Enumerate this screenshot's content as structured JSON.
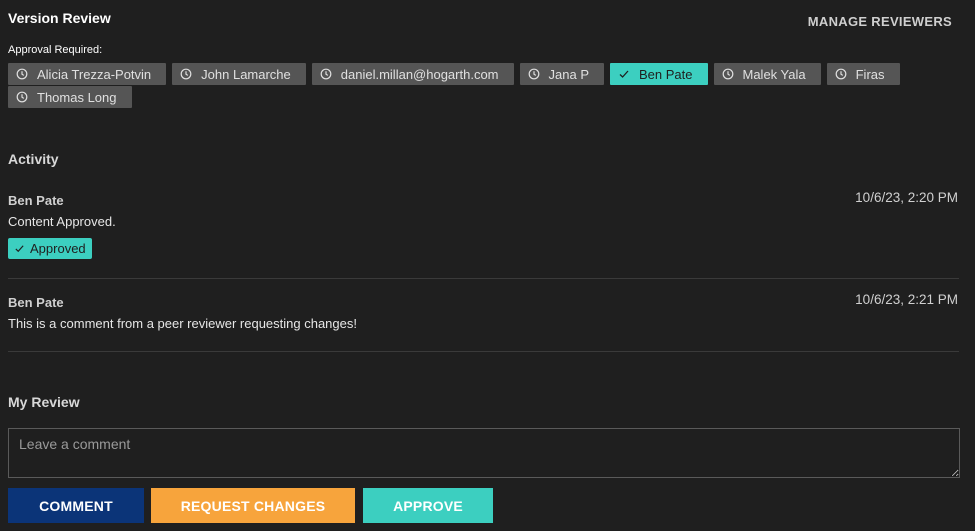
{
  "header": {
    "title": "Version Review",
    "manage_label": "MANAGE REVIEWERS"
  },
  "approval": {
    "label": "Approval Required:",
    "reviewers": [
      {
        "name": "Alicia Trezza-Potvin",
        "status": "pending",
        "icon": "clock-icon"
      },
      {
        "name": "John Lamarche",
        "status": "pending",
        "icon": "clock-icon"
      },
      {
        "name": "daniel.millan@hogarth.com",
        "status": "pending",
        "icon": "clock-icon"
      },
      {
        "name": "Jana P",
        "status": "pending",
        "icon": "clock-icon"
      },
      {
        "name": "Ben Pate",
        "status": "approved",
        "icon": "check-icon"
      },
      {
        "name": "Malek Yala",
        "status": "pending",
        "icon": "clock-icon"
      },
      {
        "name": "Firas",
        "status": "pending",
        "icon": "clock-icon"
      },
      {
        "name": "Thomas Long",
        "status": "pending",
        "icon": "clock-icon"
      }
    ]
  },
  "activity": {
    "title": "Activity",
    "items": [
      {
        "author": "Ben Pate",
        "time": "10/6/23, 2:20 PM",
        "text": "Content Approved.",
        "badge": "Approved"
      },
      {
        "author": "Ben Pate",
        "time": "10/6/23, 2:21 PM",
        "text": "This is a comment from a peer reviewer requesting changes!"
      }
    ]
  },
  "my_review": {
    "title": "My Review",
    "comment_placeholder": "Leave a comment",
    "comment_value": "",
    "buttons": {
      "comment": "COMMENT",
      "request_changes": "REQUEST CHANGES",
      "approve": "APPROVE"
    }
  },
  "colors": {
    "background": "#1f1f1f",
    "chip_pending": "#555555",
    "accent_teal": "#3ccfc0",
    "button_comment": "#0b3478",
    "button_request": "#f7a43c"
  }
}
